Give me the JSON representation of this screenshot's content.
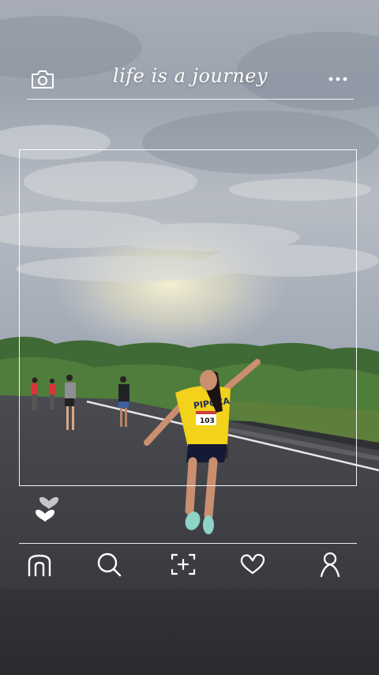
{
  "header": {
    "title": "life is a journey",
    "camera_icon": "camera-icon",
    "more_icon": "more-dots-icon"
  },
  "frame": {
    "like_icon": "heart-icon"
  },
  "photo": {
    "bib_number": "103",
    "shirt_text": "PIPOCA"
  },
  "bottom_nav": {
    "items": [
      {
        "icon": "home-icon"
      },
      {
        "icon": "search-icon"
      },
      {
        "icon": "add-post-icon"
      },
      {
        "icon": "heart-outline-icon"
      },
      {
        "icon": "profile-icon"
      }
    ]
  },
  "colors": {
    "line": "#ffffff",
    "shirt": "#f2d21a",
    "road": "#3a3b3f"
  }
}
